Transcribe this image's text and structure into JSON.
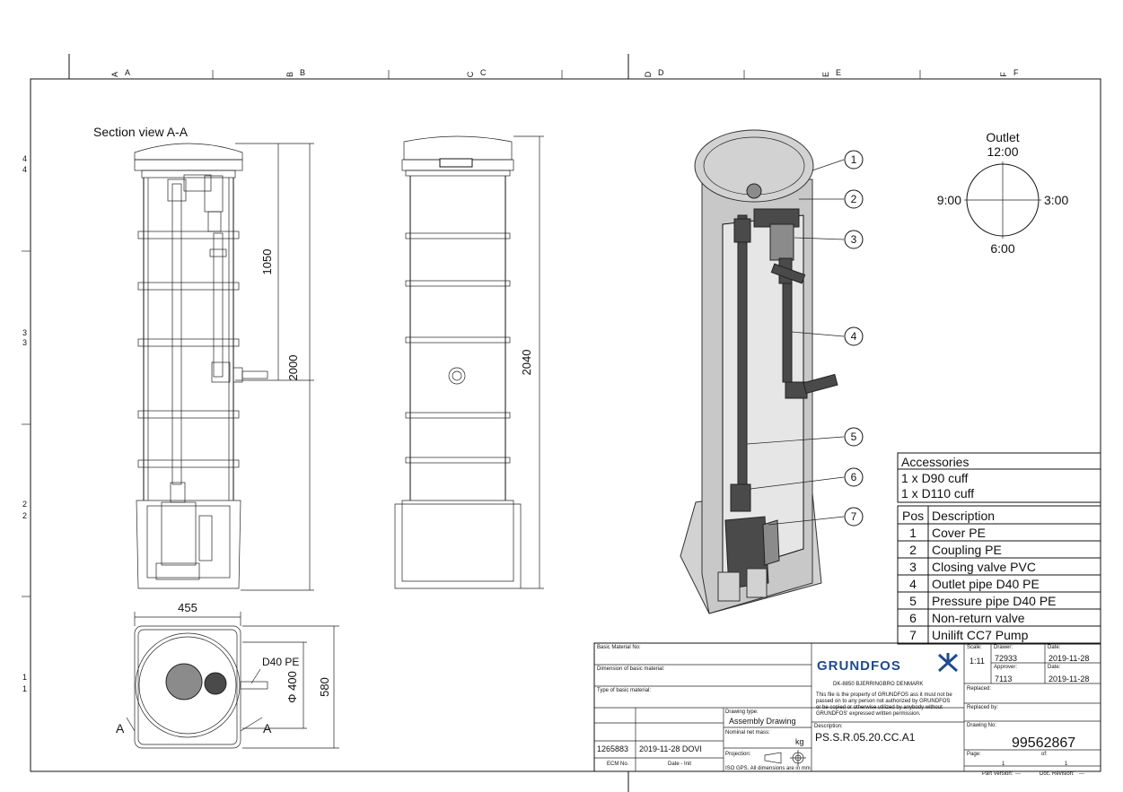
{
  "frame": {
    "columns": [
      "A",
      "B",
      "C",
      "D",
      "E",
      "F"
    ],
    "rows": [
      "4",
      "3",
      "2",
      "1"
    ]
  },
  "section_view": {
    "title": "Section view A-A",
    "dim_1050": "1050",
    "dim_2000": "2000",
    "cut_label_left": "A",
    "cut_label_right": "A"
  },
  "side_view": {
    "dim_2040": "2040"
  },
  "top_view": {
    "width": "455",
    "depth": "580",
    "diameter": "Φ 400",
    "outlet_label": "D40 PE"
  },
  "outlet_clock": {
    "title": "Outlet",
    "twelve": "12:00",
    "three": "3:00",
    "six": "6:00",
    "nine": "9:00"
  },
  "callouts": [
    "1",
    "2",
    "3",
    "4",
    "5",
    "6",
    "7"
  ],
  "accessories": {
    "title": "Accessories",
    "items": [
      "1 x D90 cuff",
      "1 x D110 cuff"
    ]
  },
  "parts_table": {
    "headers": [
      "Pos",
      "Description"
    ],
    "rows": [
      {
        "pos": "1",
        "desc": "Cover PE"
      },
      {
        "pos": "2",
        "desc": "Coupling PE"
      },
      {
        "pos": "3",
        "desc": "Closing valve PVC"
      },
      {
        "pos": "4",
        "desc": "Outlet pipe D40 PE"
      },
      {
        "pos": "5",
        "desc": "Pressure pipe D40 PE"
      },
      {
        "pos": "6",
        "desc": "Non-return valve"
      },
      {
        "pos": "7",
        "desc": "Unilift CC7 Pump"
      }
    ]
  },
  "title_block": {
    "basic_material_no": "Basic Material No:",
    "dimension_basic_material": "Dimension of basic material:",
    "type_basic_material": "Type of basic material:",
    "ecm_value": "1265883",
    "date_init_value": "2019-11-28 DOVI",
    "ecm_label": "ECM No.",
    "date_init_label": "Date - Init",
    "drawing_type_label": "Drawing type:",
    "drawing_type": "Assembly Drawing",
    "net_mass_label": "Nominal net mass:",
    "mass_unit": "kg",
    "projection_label": "Projection:",
    "iso_note": "ISO GPS.  All dimensions are in mm",
    "brand": "GRUNDFOS",
    "address": "DK-8850 BJERRINGBRO DENMARK",
    "legal": [
      "This file is the property of GRUNDFOS ass it must not be",
      "passed on to any person not authorized by GRUNDFOS",
      "or be copied or otherwise utilized by anybody without",
      "GRUNDFOS' expressed written permission."
    ],
    "description_label": "Description:",
    "description": "PS.S.R.05.20.CC.A1",
    "scale_label": "Scale:",
    "scale": "1:11",
    "drawer_label": "Drawer:",
    "drawer": "72933",
    "approver_label": "Approver:",
    "approver": "7113",
    "date_label": "Date:",
    "date_drawn": "2019-11-28",
    "date_approved": "2019-11-28",
    "replaced_label": "Replaced:",
    "replaced_by_label": "Replaced by:",
    "drawing_no_label": "Drawing No:",
    "drawing_no": "99562867",
    "page_label": "Page:",
    "of_label": "of:",
    "page": "1",
    "of": "1",
    "part_version_label": "Part Version:",
    "part_version": "---",
    "doc_revision_label": "Doc. Revision:",
    "doc_revision": "---"
  }
}
